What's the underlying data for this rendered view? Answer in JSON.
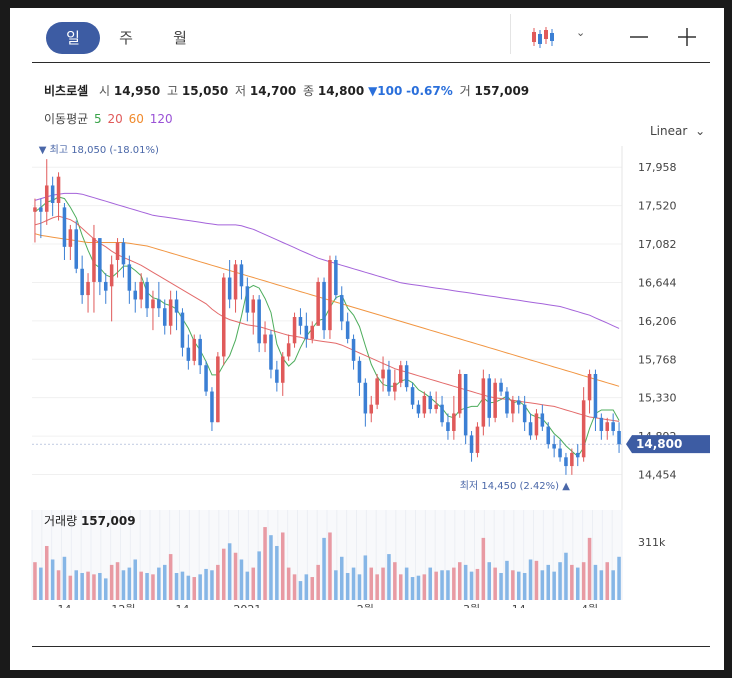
{
  "tabs": [
    {
      "label": "일",
      "active": true
    },
    {
      "label": "주",
      "active": false
    },
    {
      "label": "월",
      "active": false
    }
  ],
  "chart_type_icon": "candlestick-icon",
  "controls": {
    "scale_label": "Linear"
  },
  "quote": {
    "name": "비츠로셀",
    "open_label": "시",
    "open": "14,950",
    "high_label": "고",
    "high": "15,050",
    "low_label": "저",
    "low": "14,700",
    "close_label": "종",
    "close": "14,800",
    "change": "▼100",
    "change_pct": "-0.67%",
    "volume_label": "거",
    "volume": "157,009"
  },
  "ma_legend": {
    "label": "이동평균",
    "periods": [
      {
        "label": "5",
        "color": "#3aa44a"
      },
      {
        "label": "20",
        "color": "#e05a5a"
      },
      {
        "label": "60",
        "color": "#f08a2c"
      },
      {
        "label": "120",
        "color": "#9a52d6"
      }
    ]
  },
  "annotations": {
    "high": "▼ 최고 18,050 (-18.01%)",
    "low": "최저 14,450 (2.42%) ▲",
    "current_price": "14,800"
  },
  "volume_panel": {
    "label": "거래량",
    "value": "157,009",
    "axis_tick": "311k"
  },
  "colors": {
    "up": "#e05a5a",
    "down": "#3b7fd4",
    "up_volume": "#e89aa3",
    "down_volume": "#86b6e6",
    "accent": "#3d5ca3"
  },
  "chart_data": {
    "type": "candlestick",
    "y_ticks": [
      "17,958",
      "17,520",
      "17,082",
      "16,644",
      "16,206",
      "15,768",
      "15,330",
      "14,892",
      "14,454"
    ],
    "y_range": [
      14300,
      18200
    ],
    "x_ticks": [
      {
        "label": "14",
        "index": 5
      },
      {
        "label": "12월",
        "index": 15
      },
      {
        "label": "14",
        "index": 25
      },
      {
        "label": "2021",
        "index": 36
      },
      {
        "label": "2월",
        "index": 56
      },
      {
        "label": "3월",
        "index": 74
      },
      {
        "label": "14",
        "index": 82
      },
      {
        "label": "4월",
        "index": 94
      }
    ],
    "candles": [
      [
        17450,
        17600,
        17100,
        17500,
        140
      ],
      [
        17500,
        17600,
        17150,
        17450,
        120
      ],
      [
        17450,
        18050,
        17300,
        17750,
        200
      ],
      [
        17750,
        17850,
        17400,
        17550,
        150
      ],
      [
        17550,
        17900,
        17350,
        17850,
        110
      ],
      [
        17500,
        17550,
        16900,
        17050,
        160
      ],
      [
        17050,
        17300,
        16900,
        17250,
        90
      ],
      [
        17250,
        17350,
        16750,
        16800,
        110
      ],
      [
        16800,
        16950,
        16400,
        16500,
        100
      ],
      [
        16500,
        16750,
        16300,
        16650,
        105
      ],
      [
        16650,
        17300,
        16300,
        17150,
        95
      ],
      [
        17150,
        17150,
        16500,
        16650,
        100
      ],
      [
        16650,
        16750,
        16400,
        16550,
        80
      ],
      [
        16600,
        16950,
        16200,
        16850,
        130
      ],
      [
        16900,
        17150,
        16700,
        17100,
        140
      ],
      [
        17100,
        17150,
        16700,
        16850,
        110
      ],
      [
        16850,
        16950,
        16400,
        16550,
        120
      ],
      [
        16550,
        16650,
        16300,
        16450,
        150
      ],
      [
        16450,
        16750,
        16350,
        16650,
        105
      ],
      [
        16650,
        16700,
        16250,
        16350,
        100
      ],
      [
        16350,
        16550,
        16100,
        16450,
        95
      ],
      [
        16450,
        16650,
        16250,
        16350,
        120
      ],
      [
        16350,
        16450,
        16050,
        16150,
        130
      ],
      [
        16150,
        16550,
        16050,
        16450,
        170
      ],
      [
        16450,
        16550,
        16100,
        16300,
        100
      ],
      [
        16300,
        16350,
        15800,
        15900,
        105
      ],
      [
        15900,
        16050,
        15650,
        15750,
        90
      ],
      [
        15750,
        16050,
        15700,
        16000,
        85
      ],
      [
        16000,
        16050,
        15600,
        15700,
        95
      ],
      [
        15700,
        15750,
        15350,
        15400,
        115
      ],
      [
        15400,
        15450,
        14950,
        15050,
        110
      ],
      [
        15050,
        15850,
        15050,
        15800,
        130
      ],
      [
        15800,
        16750,
        15700,
        16700,
        190
      ],
      [
        16700,
        16900,
        16350,
        16450,
        210
      ],
      [
        16450,
        16900,
        16300,
        16850,
        175
      ],
      [
        16850,
        16900,
        16450,
        16600,
        150
      ],
      [
        16600,
        16700,
        16200,
        16300,
        105
      ],
      [
        16300,
        16500,
        16050,
        16450,
        120
      ],
      [
        16450,
        16500,
        15850,
        15950,
        180
      ],
      [
        15950,
        16200,
        15850,
        16050,
        270
      ],
      [
        16050,
        16100,
        15550,
        15650,
        240
      ],
      [
        15650,
        15750,
        15400,
        15500,
        200
      ],
      [
        15500,
        15850,
        15350,
        15800,
        250
      ],
      [
        15800,
        16050,
        15750,
        15950,
        120
      ],
      [
        15950,
        16300,
        15900,
        16250,
        95
      ],
      [
        16250,
        16350,
        16050,
        16150,
        70
      ],
      [
        16150,
        16300,
        15900,
        16000,
        95
      ],
      [
        16000,
        16200,
        15950,
        16150,
        85
      ],
      [
        16150,
        16700,
        16150,
        16650,
        130
      ],
      [
        16650,
        16700,
        16000,
        16100,
        230
      ],
      [
        16100,
        16950,
        16000,
        16900,
        250
      ],
      [
        16900,
        16950,
        16450,
        16500,
        110
      ],
      [
        16500,
        16600,
        16100,
        16200,
        160
      ],
      [
        16200,
        16300,
        15950,
        16000,
        100
      ],
      [
        16000,
        16050,
        15650,
        15750,
        120
      ],
      [
        15750,
        15800,
        15350,
        15500,
        95
      ],
      [
        15500,
        15550,
        15000,
        15150,
        165
      ],
      [
        15150,
        15350,
        15050,
        15250,
        120
      ],
      [
        15250,
        15600,
        15200,
        15550,
        95
      ],
      [
        15550,
        15800,
        15400,
        15650,
        120
      ],
      [
        15650,
        15750,
        15350,
        15400,
        170
      ],
      [
        15400,
        15650,
        15300,
        15500,
        140
      ],
      [
        15500,
        15750,
        15450,
        15700,
        95
      ],
      [
        15700,
        15750,
        15400,
        15450,
        120
      ],
      [
        15450,
        15500,
        15200,
        15250,
        85
      ],
      [
        15250,
        15300,
        15100,
        15150,
        90
      ],
      [
        15150,
        15400,
        15100,
        15350,
        95
      ],
      [
        15350,
        15400,
        15150,
        15200,
        120
      ],
      [
        15200,
        15400,
        15150,
        15250,
        105
      ],
      [
        15250,
        15350,
        15000,
        15050,
        110
      ],
      [
        15050,
        15150,
        14850,
        14950,
        110
      ],
      [
        14950,
        15350,
        14850,
        15150,
        120
      ],
      [
        15150,
        15650,
        15100,
        15600,
        140
      ],
      [
        15600,
        15600,
        14800,
        14900,
        130
      ],
      [
        14900,
        14950,
        14600,
        14700,
        105
      ],
      [
        14700,
        15050,
        14650,
        15000,
        115
      ],
      [
        15000,
        15650,
        14900,
        15550,
        230
      ],
      [
        15550,
        15600,
        15000,
        15100,
        140
      ],
      [
        15100,
        15550,
        15050,
        15500,
        120
      ],
      [
        15500,
        15550,
        15350,
        15400,
        100
      ],
      [
        15400,
        15450,
        15100,
        15150,
        145
      ],
      [
        15150,
        15350,
        15050,
        15300,
        110
      ],
      [
        15300,
        15350,
        15150,
        15250,
        105
      ],
      [
        15250,
        15350,
        14950,
        15050,
        100
      ],
      [
        15050,
        15150,
        14850,
        14900,
        150
      ],
      [
        14900,
        15200,
        14850,
        15150,
        145
      ],
      [
        15150,
        15250,
        14950,
        15000,
        110
      ],
      [
        15000,
        15050,
        14750,
        14800,
        130
      ],
      [
        14800,
        14900,
        14650,
        14750,
        105
      ],
      [
        14750,
        14850,
        14600,
        14650,
        140
      ],
      [
        14650,
        14700,
        14450,
        14550,
        175
      ],
      [
        14550,
        14750,
        14450,
        14700,
        130
      ],
      [
        14700,
        14800,
        14550,
        14650,
        120
      ],
      [
        14650,
        15450,
        14600,
        15300,
        140
      ],
      [
        15300,
        15650,
        15150,
        15600,
        230
      ],
      [
        15600,
        15650,
        14950,
        15100,
        130
      ],
      [
        15100,
        15150,
        14850,
        14950,
        110
      ],
      [
        14950,
        15100,
        14850,
        15050,
        140
      ],
      [
        15050,
        15150,
        14900,
        14950,
        110
      ],
      [
        14950,
        15050,
        14700,
        14800,
        160
      ]
    ],
    "moving_averages": [
      {
        "period": "5",
        "color": "#3aa44a",
        "values": [
          17450,
          17500,
          17560,
          17580,
          17620,
          17600,
          17500,
          17380,
          17180,
          17010,
          16860,
          16810,
          16730,
          16700,
          16760,
          16830,
          16830,
          16780,
          16720,
          16530,
          16470,
          16450,
          16400,
          16380,
          16340,
          16230,
          16120,
          15970,
          15870,
          15740,
          15590,
          15590,
          15710,
          15810,
          15990,
          16260,
          16570,
          16610,
          16580,
          16460,
          16300,
          15940,
          15780,
          15690,
          15750,
          15900,
          16030,
          16120,
          16210,
          16230,
          16360,
          16470,
          16500,
          16350,
          16270,
          16140,
          15920,
          15710,
          15570,
          15480,
          15460,
          15460,
          15520,
          15540,
          15500,
          15420,
          15380,
          15330,
          15270,
          15210,
          15120,
          15100,
          15190,
          15210,
          15230,
          15230,
          15330,
          15270,
          15280,
          15310,
          15350,
          15270,
          15290,
          15240,
          15140,
          15110,
          15090,
          15010,
          14920,
          14860,
          14780,
          14720,
          14660,
          14760,
          14980,
          15150,
          15190,
          15190,
          15190,
          15070
        ]
      },
      {
        "period": "20",
        "color": "#e05a5a",
        "values": [
          17300,
          17320,
          17350,
          17380,
          17400,
          17380,
          17360,
          17320,
          17260,
          17200,
          17140,
          17090,
          17050,
          17000,
          16960,
          16930,
          16900,
          16870,
          16840,
          16800,
          16760,
          16720,
          16680,
          16640,
          16600,
          16560,
          16520,
          16480,
          16440,
          16400,
          16340,
          16290,
          16250,
          16220,
          16200,
          16180,
          16160,
          16150,
          16140,
          16120,
          16100,
          16080,
          16060,
          16040,
          16030,
          16020,
          16000,
          15990,
          15980,
          15970,
          15960,
          15950,
          15930,
          15900,
          15870,
          15840,
          15810,
          15780,
          15750,
          15720,
          15690,
          15660,
          15640,
          15620,
          15600,
          15580,
          15560,
          15540,
          15520,
          15500,
          15480,
          15460,
          15440,
          15420,
          15400,
          15380,
          15360,
          15340,
          15330,
          15320,
          15310,
          15300,
          15290,
          15280,
          15270,
          15260,
          15250,
          15240,
          15230,
          15210,
          15190,
          15170,
          15150,
          15130,
          15110,
          15100,
          15090,
          15080,
          15070,
          15060
        ]
      },
      {
        "period": "60",
        "color": "#f08a2c",
        "values": [
          17200,
          17180,
          17170,
          17160,
          17150,
          17140,
          17130,
          17120,
          17110,
          17100,
          17100,
          17100,
          17100,
          17100,
          17100,
          17100,
          17090,
          17080,
          17070,
          17060,
          17040,
          17020,
          17000,
          16980,
          16960,
          16940,
          16920,
          16900,
          16880,
          16860,
          16840,
          16820,
          16800,
          16780,
          16760,
          16740,
          16720,
          16700,
          16680,
          16660,
          16640,
          16620,
          16600,
          16580,
          16560,
          16540,
          16520,
          16500,
          16480,
          16460,
          16440,
          16420,
          16400,
          16380,
          16360,
          16340,
          16320,
          16300,
          16280,
          16260,
          16240,
          16220,
          16200,
          16180,
          16160,
          16140,
          16120,
          16100,
          16080,
          16060,
          16040,
          16020,
          16000,
          15980,
          15960,
          15940,
          15920,
          15900,
          15880,
          15860,
          15840,
          15820,
          15800,
          15780,
          15760,
          15740,
          15720,
          15700,
          15680,
          15660,
          15640,
          15620,
          15600,
          15580,
          15560,
          15540,
          15520,
          15500,
          15480,
          15460
        ]
      },
      {
        "period": "120",
        "color": "#9a52d6",
        "values": [
          17580,
          17600,
          17620,
          17640,
          17650,
          17660,
          17660,
          17660,
          17650,
          17630,
          17610,
          17590,
          17570,
          17550,
          17530,
          17510,
          17490,
          17470,
          17450,
          17430,
          17410,
          17400,
          17390,
          17380,
          17370,
          17360,
          17350,
          17340,
          17330,
          17320,
          17310,
          17300,
          17300,
          17300,
          17300,
          17290,
          17270,
          17250,
          17220,
          17190,
          17160,
          17130,
          17100,
          17070,
          17040,
          17010,
          16980,
          16950,
          16920,
          16900,
          16880,
          16860,
          16840,
          16820,
          16800,
          16780,
          16760,
          16740,
          16720,
          16700,
          16680,
          16660,
          16640,
          16630,
          16620,
          16610,
          16600,
          16590,
          16580,
          16570,
          16560,
          16550,
          16540,
          16530,
          16520,
          16510,
          16500,
          16490,
          16480,
          16470,
          16460,
          16450,
          16440,
          16430,
          16420,
          16410,
          16400,
          16390,
          16380,
          16370,
          16350,
          16330,
          16310,
          16290,
          16270,
          16240,
          16210,
          16180,
          16150,
          16120
        ]
      }
    ]
  }
}
